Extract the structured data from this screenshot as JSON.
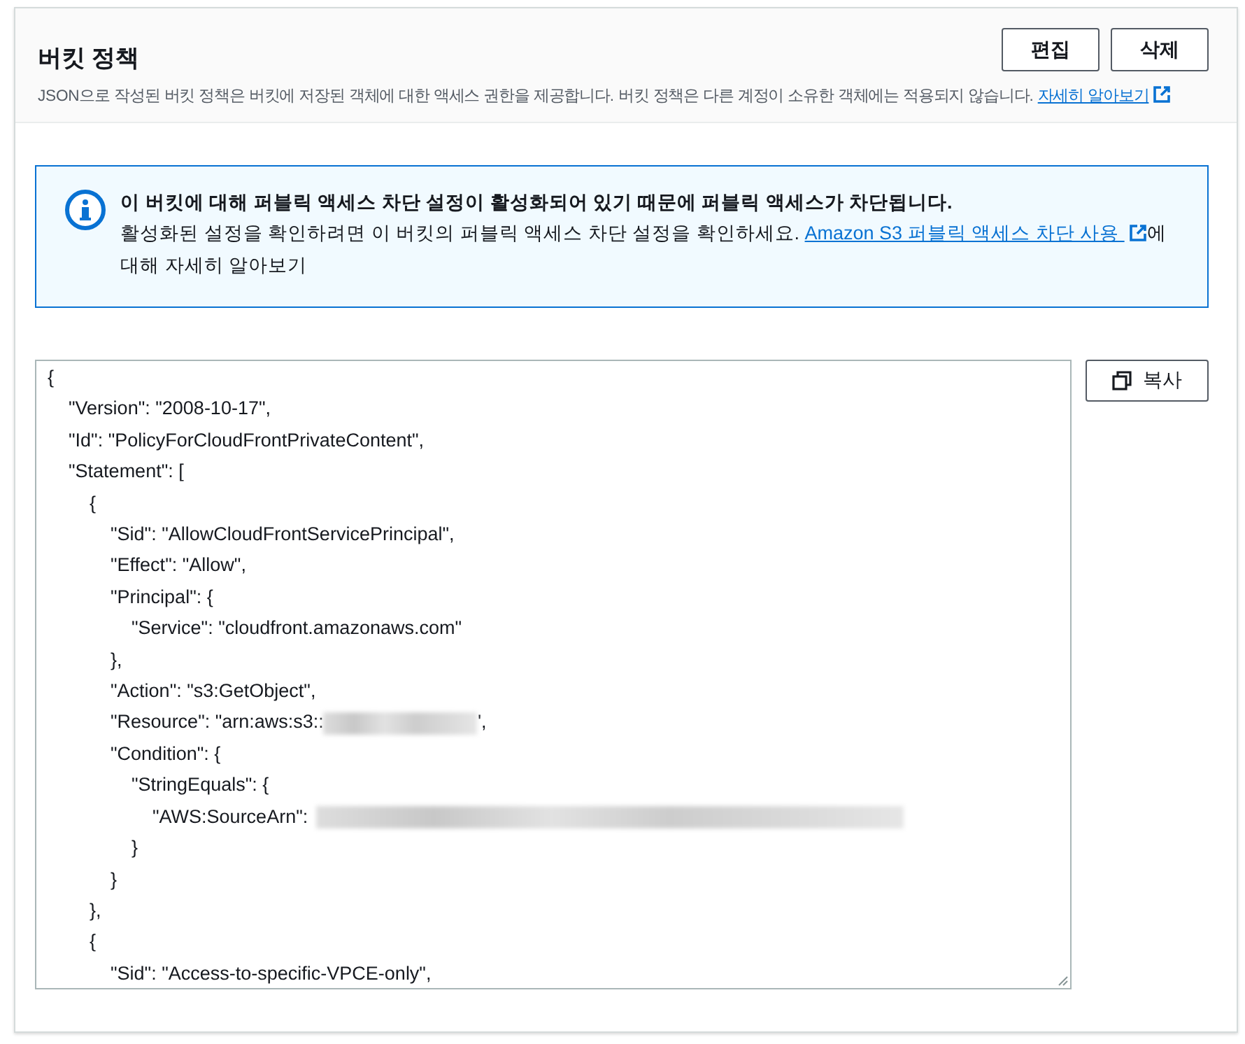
{
  "panel": {
    "title": "버킷 정책",
    "description": "JSON으로 작성된 버킷 정책은 버킷에 저장된 객체에 대한 액세스 권한을 제공합니다. 버킷 정책은 다른 계정이 소유한 객체에는 적용되지 않습니다.",
    "learn_more_link": "자세히 알아보기",
    "buttons": [
      "편집",
      "삭제"
    ]
  },
  "alert": {
    "title": "이 버킷에 대해 퍼블릭 액세스 차단 설정이 활성화되어 있기 때문에 퍼블릭 액세스가 차단됩니다.",
    "text_before": "활성화된 설정을 확인하려면 이 버킷의 퍼블릭 액세스 차단 설정을 확인하세요.",
    "link": "Amazon S3 퍼블릭 액세스 차단 사용",
    "text_after": "에 대해 자세히 알아보기"
  },
  "policy_editor": {
    "copy_button": "복사",
    "lines": [
      {
        "text": "{",
        "redacted": false,
        "children": [
          {
            "text": "\"Version\": \"2008-10-17\",",
            "redacted": false
          },
          {
            "text": "\"Id\": \"PolicyForCloudFrontPrivateContent\",",
            "redacted": false
          },
          {
            "text": "\"Statement\": [",
            "redacted": false,
            "children": [
              {
                "text": "{",
                "redacted": false,
                "children": [
                  {
                    "text": "\"Sid\": \"AllowCloudFrontServicePrincipal\",",
                    "redacted": false
                  },
                  {
                    "text": "\"Effect\": \"Allow\",",
                    "redacted": false
                  },
                  {
                    "text": "\"Principal\": {",
                    "redacted": false,
                    "children": [
                      {
                        "text": "\"Service\": \"cloudfront.amazonaws.com\"",
                        "redacted": false
                      }
                    ]
                  },
                  {
                    "text": "},",
                    "redacted": false
                  },
                  {
                    "text": "\"Action\": \"s3:GetObject\",",
                    "redacted": false
                  },
                  {
                    "text": "\"Resource\": \"arn:aws:s3::",
                    "redacted": true,
                    "tail": "',"
                  },
                  {
                    "text": "\"Condition\": {",
                    "redacted": false,
                    "children": [
                      {
                        "text": "\"StringEquals\": {",
                        "redacted": false,
                        "children": [
                          {
                            "text": "\"AWS:SourceArn\":",
                            "redacted": true
                          }
                        ]
                      },
                      {
                        "text": "}",
                        "redacted": false
                      }
                    ]
                  },
                  {
                    "text": "}",
                    "redacted": false
                  }
                ]
              },
              {
                "text": "},",
                "redacted": false
              },
              {
                "text": "{",
                "redacted": false,
                "children": [
                  {
                    "text": "\"Sid\": \"Access-to-specific-VPCE-only\",",
                    "redacted": false
                  }
                ]
              }
            ]
          }
        ]
      }
    ]
  }
}
